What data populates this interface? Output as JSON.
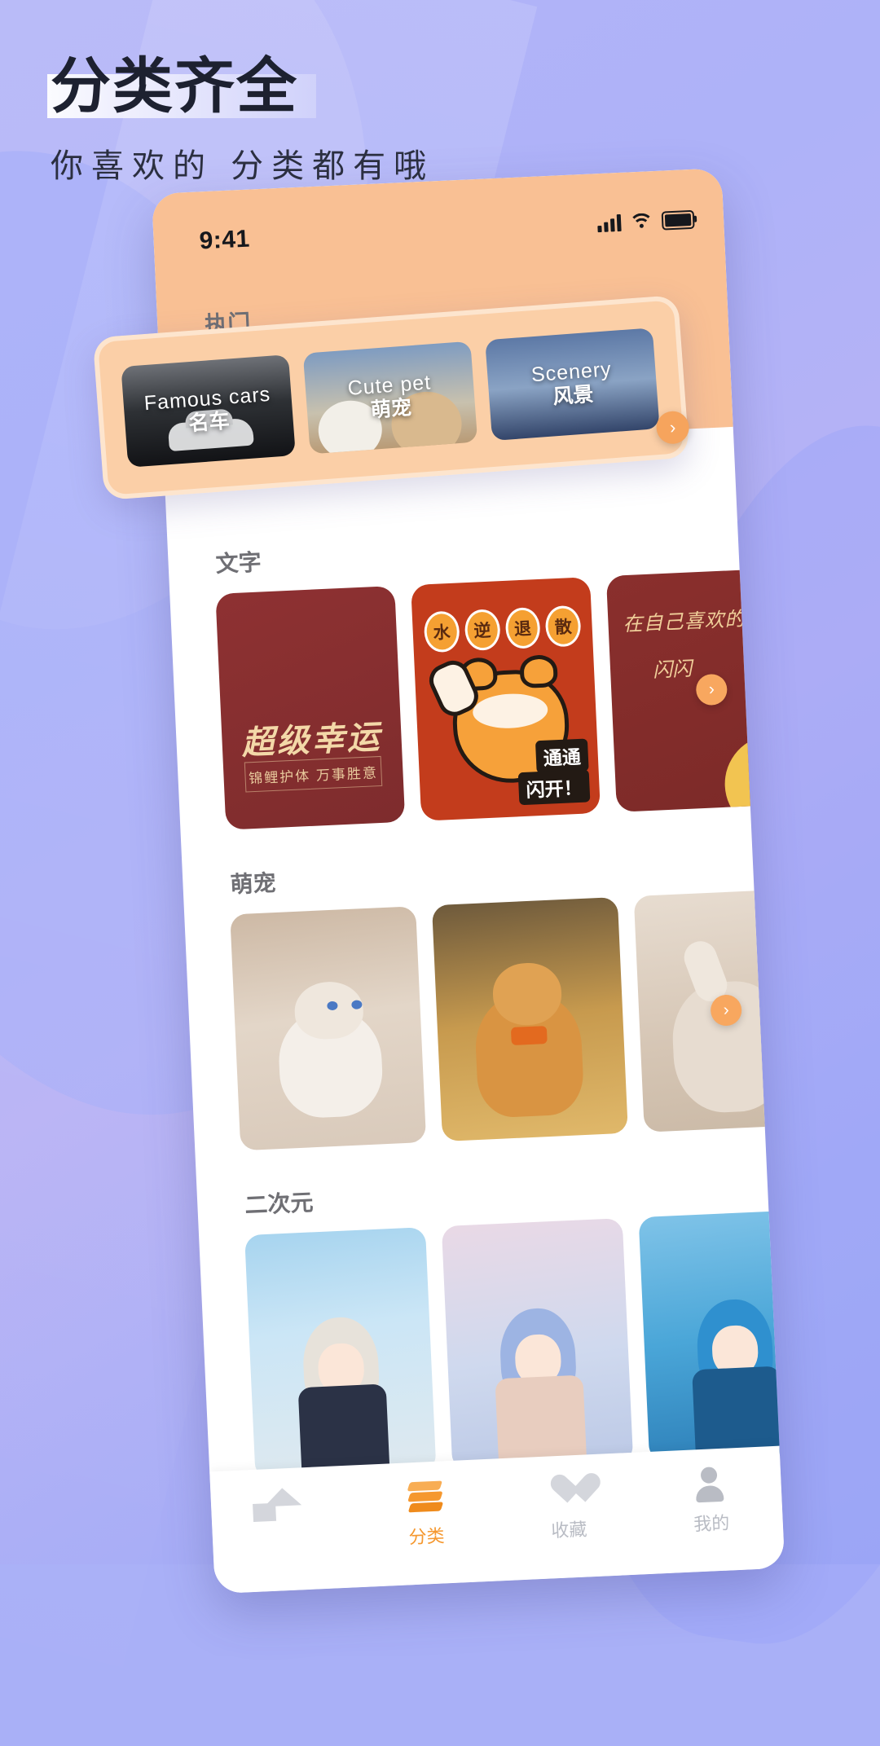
{
  "headline": {
    "title": "分类齐全",
    "subtitle": "你喜欢的  分类都有哦"
  },
  "phone": {
    "status": {
      "time": "9:41",
      "signal_icon": "signal-bars-icon",
      "wifi_icon": "wifi-icon",
      "battery_icon": "battery-icon"
    },
    "sections": [
      {
        "id": "hot",
        "title": "执门",
        "arrow": "›",
        "tiles": [
          {
            "en": "Famous cars",
            "cn": "名车",
            "theme": "cars"
          },
          {
            "en": "Cute pet",
            "cn": "萌宠",
            "theme": "pet"
          },
          {
            "en": "Scenery",
            "cn": "风景",
            "theme": "scen"
          }
        ]
      },
      {
        "id": "text",
        "title": "文字",
        "arrow": "›",
        "cards": [
          {
            "line1": "超级幸运",
            "line2": "锦鲤护体 万事胜意"
          },
          {
            "bubbles": [
              "水",
              "逆",
              "退",
              "散"
            ],
            "badge1": "通通",
            "badge2": "闪开！"
          },
          {
            "q1": "在自己喜欢的",
            "q2": "闪闪"
          }
        ]
      },
      {
        "id": "pets",
        "title": "萌宠",
        "arrow": "›",
        "cards": [
          "ragdoll-cat-photo",
          "corgi-dog-photo",
          "playing-cat-photo"
        ]
      },
      {
        "id": "anime",
        "title": "二次元",
        "cards": [
          "anime-girl-school",
          "anime-girl-pink",
          "anime-girl-blue"
        ]
      }
    ],
    "nav": [
      {
        "label": "",
        "icon": "home-icon",
        "active": false
      },
      {
        "label": "分类",
        "icon": "layers-icon",
        "active": true
      },
      {
        "label": "收藏",
        "icon": "heart-icon",
        "active": false
      },
      {
        "label": "我的",
        "icon": "user-icon",
        "active": false
      }
    ]
  },
  "colors": {
    "background": "#aeb2f8",
    "phone_header": "#f9c094",
    "accent": "#f5982f",
    "hot_card": "#fbcfa7"
  }
}
